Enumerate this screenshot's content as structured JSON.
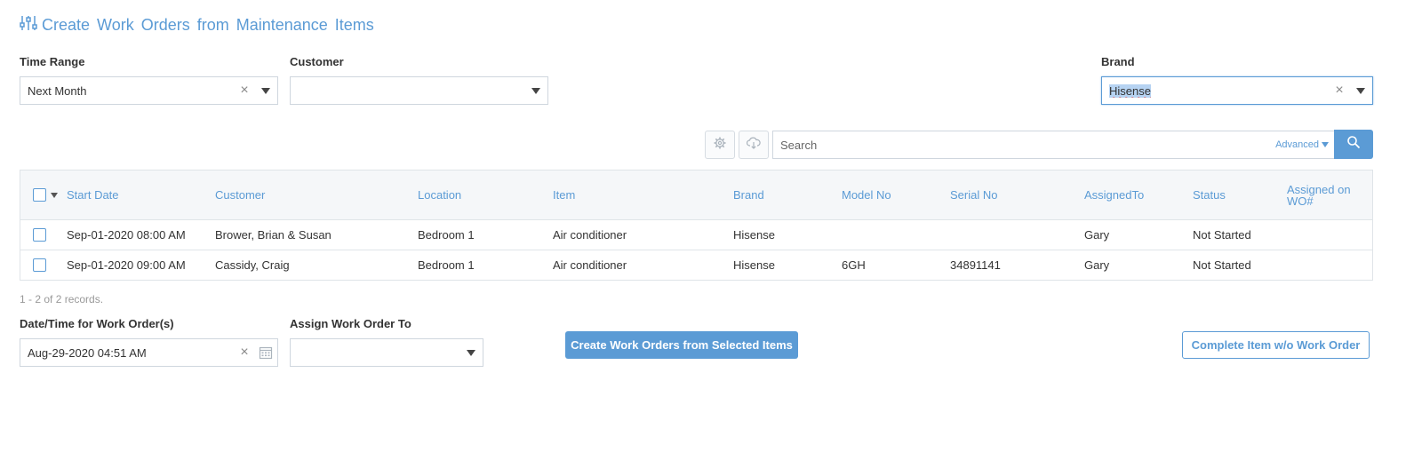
{
  "page": {
    "title": "Create  Work  Orders  from  Maintenance  Items",
    "title_icon": "sliders-icon",
    "accent_color": "#5b9bd5"
  },
  "filters": {
    "time_range": {
      "label": "Time Range",
      "value": "Next Month"
    },
    "customer": {
      "label": "Customer",
      "value": ""
    },
    "brand": {
      "label": "Brand",
      "value": "Hisense"
    }
  },
  "toolbar": {
    "settings_icon": "gear-icon",
    "export_icon": "cloud-download-icon",
    "search_placeholder": "Search",
    "advanced_label": "Advanced",
    "search_icon": "search-icon"
  },
  "grid": {
    "columns": [
      "Start Date",
      "Customer",
      "Location",
      "Item",
      "Brand",
      "Model No",
      "Serial No",
      "AssignedTo",
      "Status",
      "Assigned on WO#"
    ],
    "rows": [
      [
        "Sep-01-2020 08:00 AM",
        "Brower, Brian & Susan",
        "Bedroom 1",
        "Air conditioner",
        "Hisense",
        "",
        "",
        "Gary",
        "Not Started",
        ""
      ],
      [
        "Sep-01-2020 09:00 AM",
        "Cassidy, Craig",
        "Bedroom 1",
        "Air conditioner",
        "Hisense",
        "6GH",
        "34891141",
        "Gary",
        "Not Started",
        ""
      ]
    ],
    "records_info": "1 - 2 of 2 records."
  },
  "footer": {
    "datetime": {
      "label": "Date/Time for Work Order(s)",
      "value": "Aug-29-2020 04:51 AM"
    },
    "assign_to": {
      "label": "Assign Work Order To",
      "value": ""
    },
    "create_button": "Create Work Orders from Selected Items",
    "complete_button": "Complete Item w/o Work Order"
  }
}
